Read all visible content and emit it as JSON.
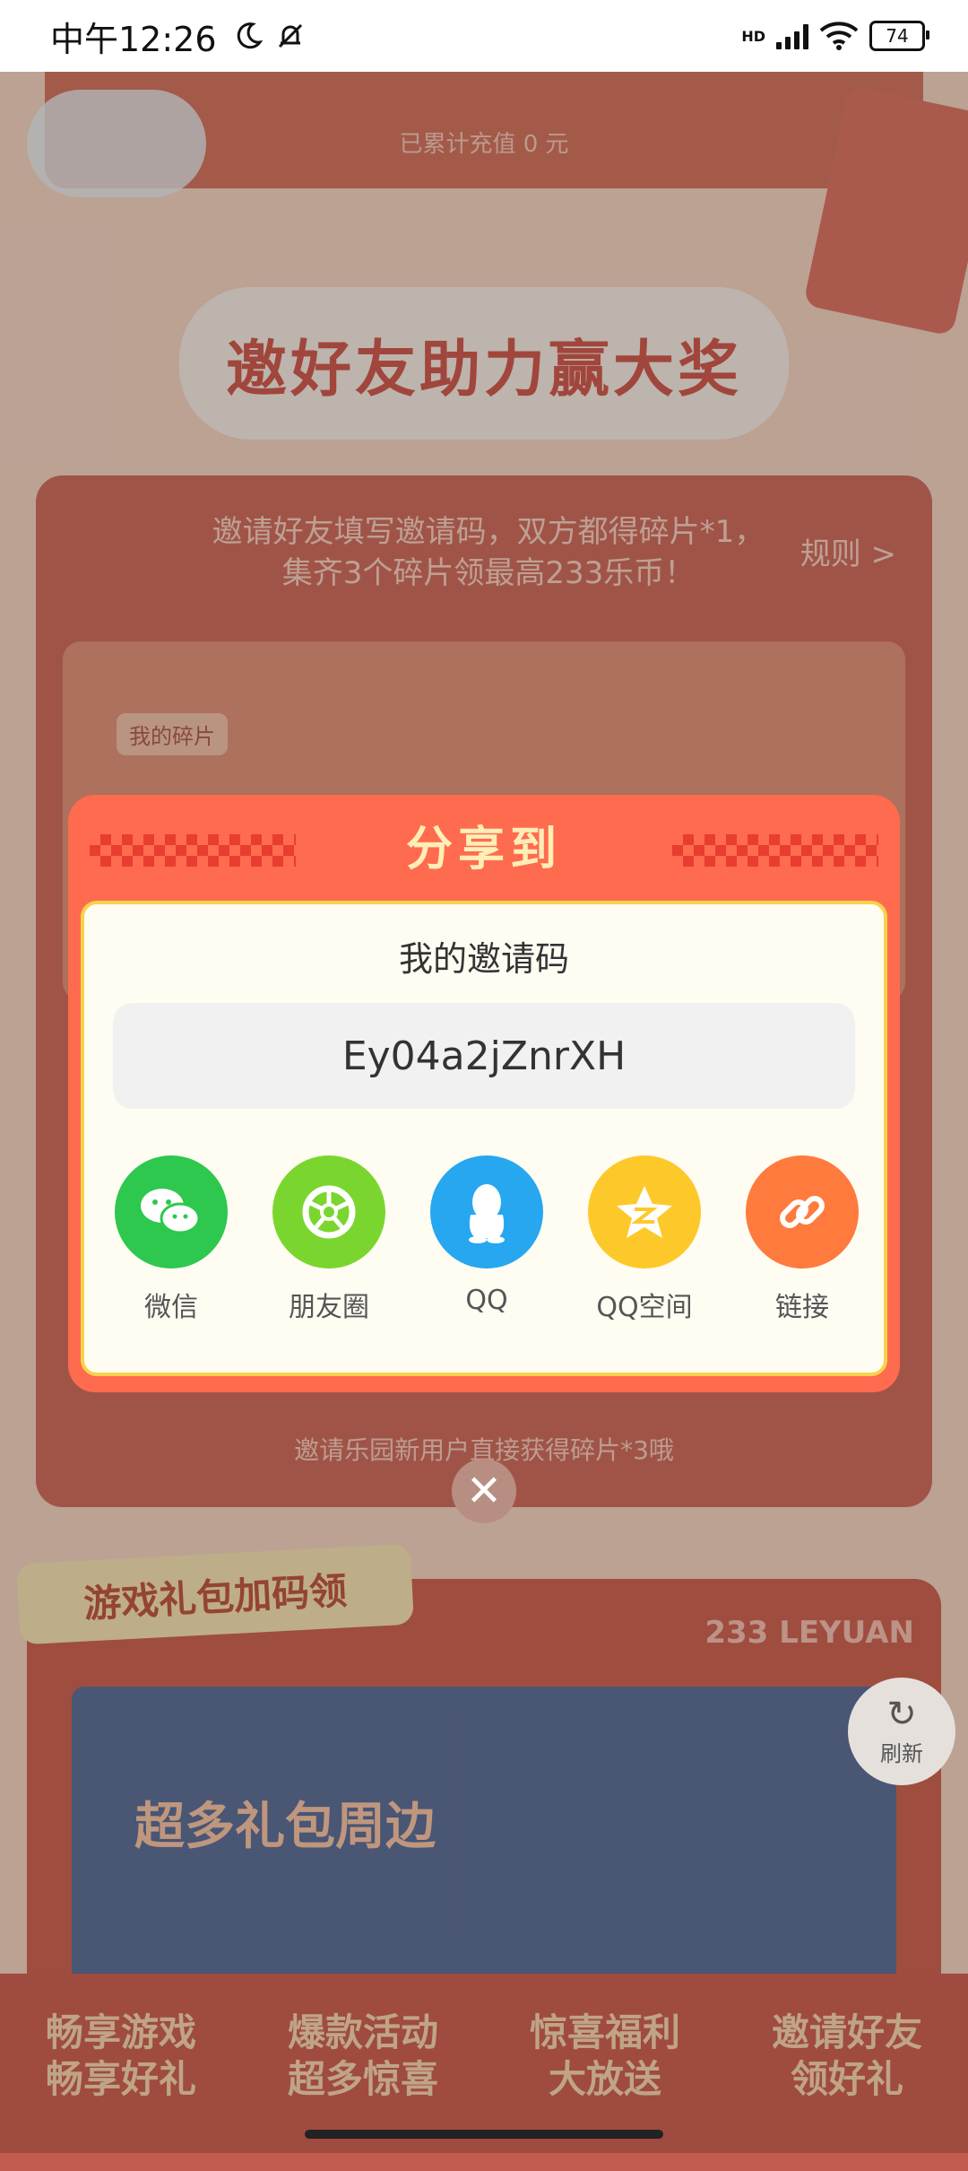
{
  "status_bar": {
    "time": "中午12:26",
    "hd_label": "HD",
    "battery": "74"
  },
  "background": {
    "recharged_text": "已累计充值 0 元",
    "invite_section": {
      "title": "邀好友助力赢大奖",
      "description": "邀请好友填写邀请码，双方都得碎片*1，集齐3个碎片领最高233乐币！",
      "rules_link": "规则 >",
      "fragment_tag": "我的碎片",
      "bottom_note": "邀请乐园新用户直接获得碎片*3哦"
    },
    "gift_section": {
      "title": "游戏礼包加码领",
      "subtitle": "233 LEYUAN",
      "banner_text": "超多礼包周边"
    },
    "refresh_label": "刷新",
    "footer_items": [
      {
        "line1": "畅享游戏",
        "line2": "畅享好礼"
      },
      {
        "line1": "爆款活动",
        "line2": "超多惊喜"
      },
      {
        "line1": "惊喜福利",
        "line2": "大放送"
      },
      {
        "line1": "邀请好友",
        "line2": "领好礼"
      }
    ]
  },
  "share_modal": {
    "title": "分享到",
    "invite_code_label": "我的邀请码",
    "invite_code": "Ey04a2jZnrXH",
    "options": [
      {
        "label": "微信",
        "icon": "wechat-icon",
        "color": "#2dc84d"
      },
      {
        "label": "朋友圈",
        "icon": "moments-icon",
        "color": "#7ad62e"
      },
      {
        "label": "QQ",
        "icon": "qq-icon",
        "color": "#27a7ef"
      },
      {
        "label": "QQ空间",
        "icon": "qzone-icon",
        "color": "#fdc92a"
      },
      {
        "label": "链接",
        "icon": "link-icon",
        "color": "#ff7a3d"
      }
    ]
  },
  "colors": {
    "modal_bg": "#ff6b4e",
    "modal_title": "#ffeeb6",
    "inner_border": "#f7d24a"
  }
}
